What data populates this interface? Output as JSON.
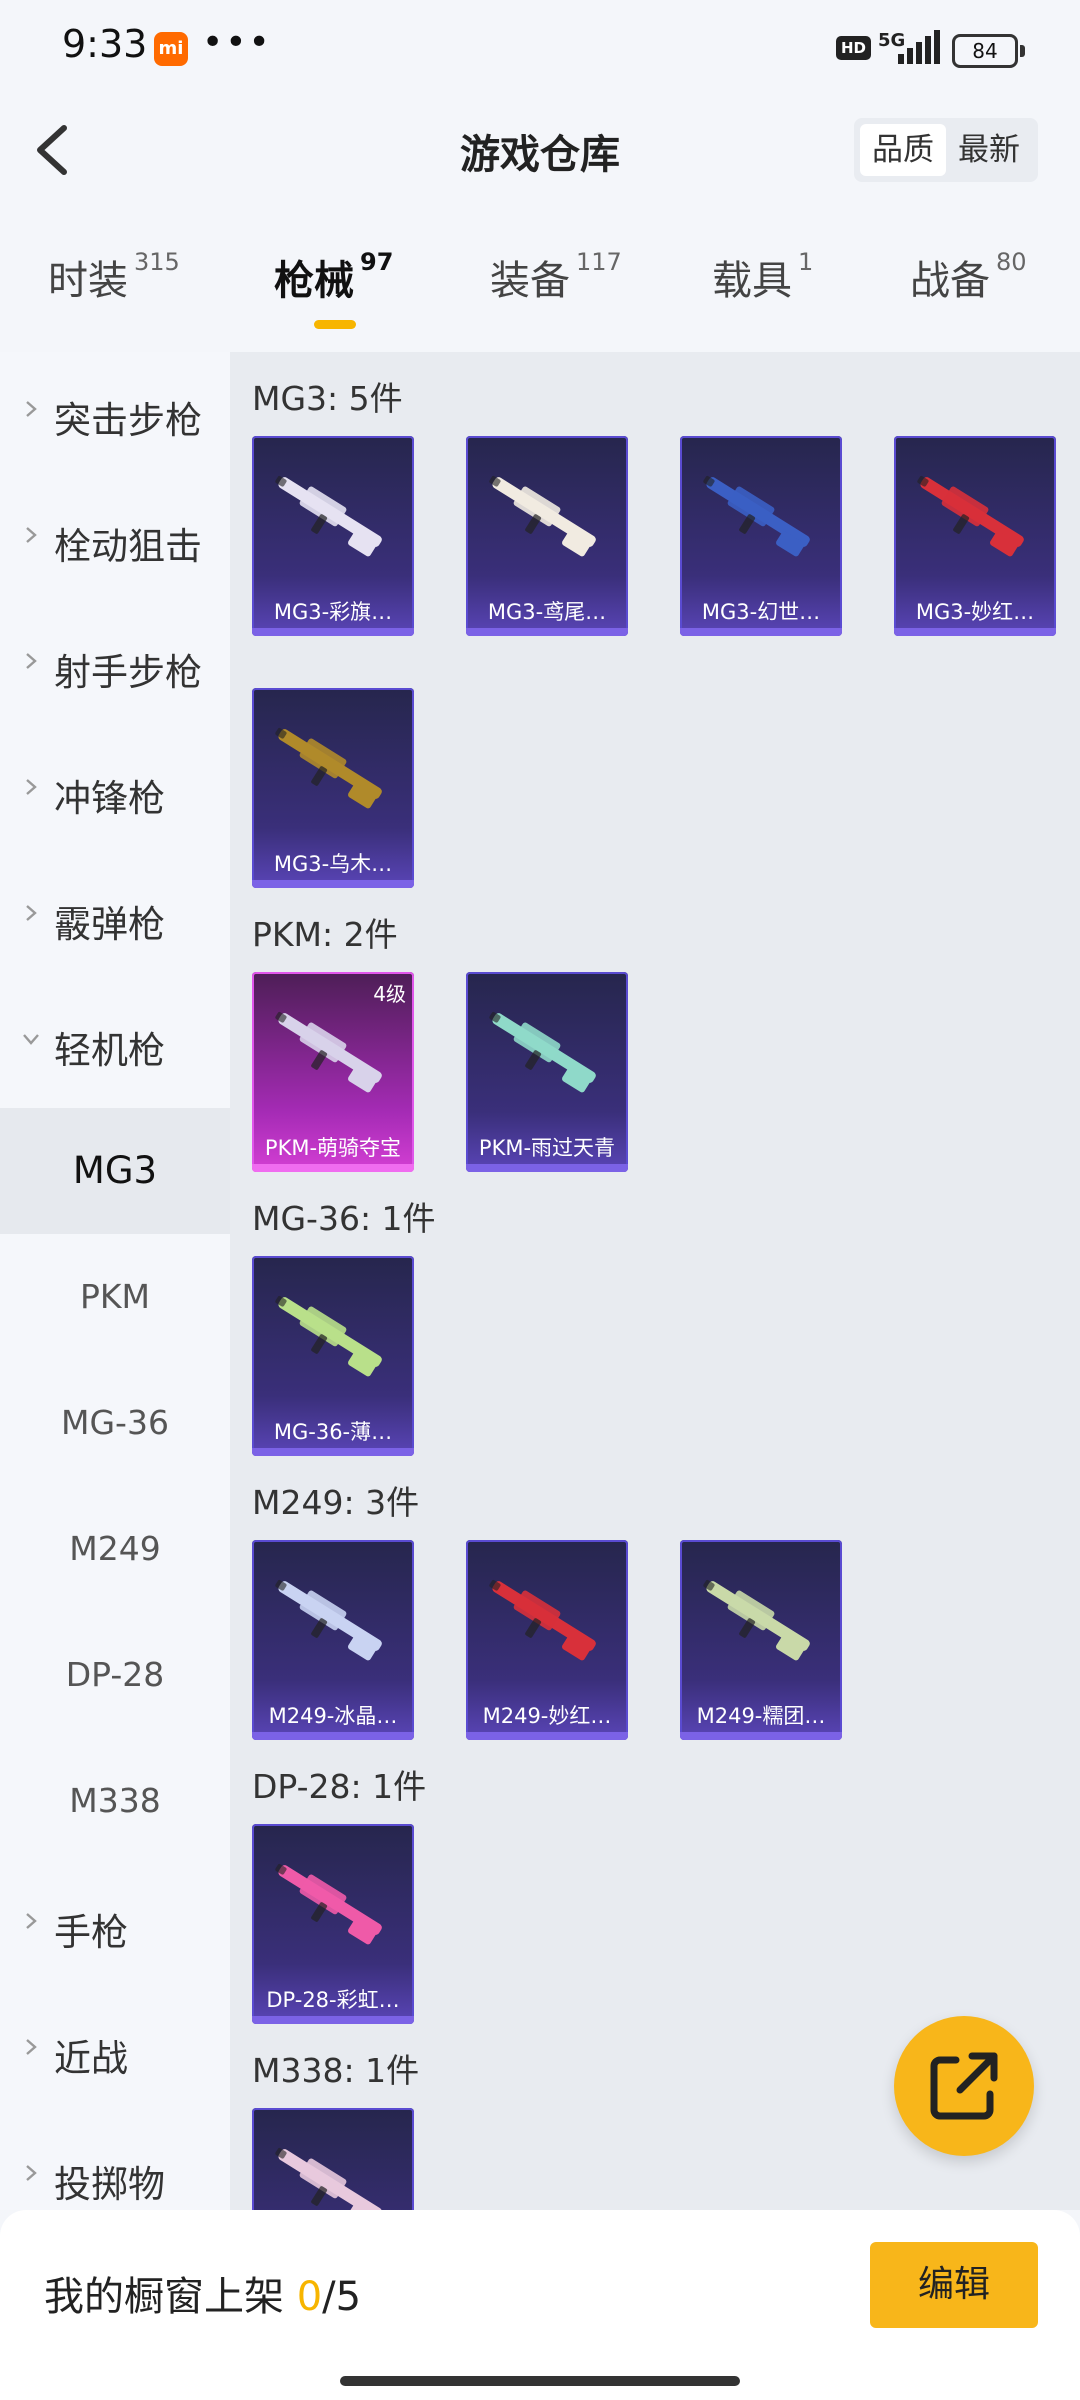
{
  "status_bar": {
    "time": "9:33",
    "mi_label": "mi",
    "dots": "•••",
    "hd": "HD",
    "network": "5G",
    "battery": "84"
  },
  "header": {
    "title": "游戏仓库",
    "sort_options": [
      "品质",
      "最新"
    ],
    "sort_selected": "品质"
  },
  "tabs": [
    {
      "label": "时装",
      "count": "315"
    },
    {
      "label": "枪械",
      "count": "97",
      "active": true
    },
    {
      "label": "装备",
      "count": "117"
    },
    {
      "label": "载具",
      "count": "1"
    },
    {
      "label": "战备",
      "count": "80"
    }
  ],
  "sidebar": {
    "categories_top": [
      "突击步枪",
      "栓动狙击",
      "射手步枪",
      "冲锋枪",
      "霰弹枪"
    ],
    "expanded_category": "轻机枪",
    "sub_items": [
      "MG3",
      "PKM",
      "MG-36",
      "M249",
      "DP-28",
      "M338"
    ],
    "selected_sub": "MG3",
    "categories_bottom": [
      "手枪",
      "近战",
      "投掷物"
    ]
  },
  "groups": [
    {
      "title": "MG3: 5件",
      "items": [
        {
          "name": "MG3-彩旗…",
          "gun_color": "#e6e2f2"
        },
        {
          "name": "MG3-鸢尾…",
          "gun_color": "#f1ebe1"
        },
        {
          "name": "MG3-幻世…",
          "gun_color": "#3b5fc4"
        },
        {
          "name": "MG3-妙红…",
          "gun_color": "#d8303a"
        },
        {
          "name": "MG3-乌木…",
          "gun_color": "#b08a2a"
        }
      ]
    },
    {
      "title": "PKM: 2件",
      "items": [
        {
          "name": "PKM-萌骑夺宝",
          "gun_color": "#d8d2ea",
          "level": "4级",
          "rare": true
        },
        {
          "name": "PKM-雨过天青",
          "gun_color": "#8fd9c9"
        }
      ]
    },
    {
      "title": "MG-36: 1件",
      "items": [
        {
          "name": "MG-36-薄…",
          "gun_color": "#b9e08a"
        }
      ]
    },
    {
      "title": "M249: 3件",
      "items": [
        {
          "name": "M249-冰晶…",
          "gun_color": "#c9d3f2"
        },
        {
          "name": "M249-妙红…",
          "gun_color": "#d8303a"
        },
        {
          "name": "M249-糯团…",
          "gun_color": "#c9d9a8"
        }
      ]
    },
    {
      "title": "DP-28: 1件",
      "items": [
        {
          "name": "DP-28-彩虹…",
          "gun_color": "#ef5aa8"
        }
      ]
    },
    {
      "title": "M338: 1件",
      "items": [
        {
          "name": "",
          "gun_color": "#e8c9dd"
        }
      ]
    }
  ],
  "bottom": {
    "shelf_prefix": "我的橱窗上架 ",
    "shelf_current": "0",
    "shelf_total": "/5",
    "edit_label": "编辑"
  },
  "colors": {
    "accent": "#f8b61a",
    "card_purple": "#3a2f7a",
    "card_pink": "#d43fd4"
  }
}
